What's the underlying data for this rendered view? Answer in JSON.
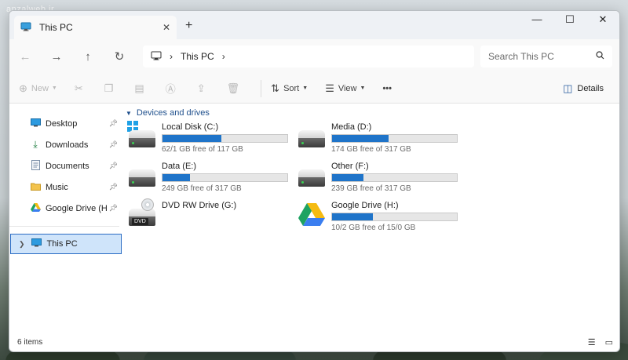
{
  "watermark": "anzalweb.ir",
  "tab": {
    "title": "This PC",
    "close": "✕",
    "new_tab": "+"
  },
  "window_controls": {
    "minimize": "—",
    "maximize": "☐",
    "close": "✕"
  },
  "nav": {
    "back": "←",
    "forward": "→",
    "up": "↑",
    "refresh": "↻"
  },
  "address": {
    "crumb": "This PC",
    "chevron": "›"
  },
  "search": {
    "placeholder": "Search This PC",
    "icon": "search-icon"
  },
  "toolbar": {
    "new_label": "New",
    "sort_label": "Sort",
    "view_label": "View",
    "more_label": "•••",
    "details_label": "Details"
  },
  "sidebar": {
    "items": [
      {
        "label": "Desktop",
        "icon": "desktop-icon",
        "pinned": true
      },
      {
        "label": "Downloads",
        "icon": "download-icon",
        "pinned": true
      },
      {
        "label": "Documents",
        "icon": "document-icon",
        "pinned": true
      },
      {
        "label": "Music",
        "icon": "folder-icon",
        "pinned": true
      },
      {
        "label": "Google Drive (H",
        "icon": "google-drive-icon",
        "pinned": true
      }
    ],
    "this_pc": "This PC"
  },
  "main": {
    "group_title": "Devices and drives",
    "drives": [
      {
        "name": "Local Disk (C:)",
        "free": "62/1 GB free of 117 GB",
        "used_fraction": 0.47,
        "icon": "windows-drive-icon"
      },
      {
        "name": "Media (D:)",
        "free": "174 GB free of 317 GB",
        "used_fraction": 0.45,
        "icon": "hard-drive-icon"
      },
      {
        "name": "Data (E:)",
        "free": "249 GB free of 317 GB",
        "used_fraction": 0.22,
        "icon": "hard-drive-icon"
      },
      {
        "name": "Other (F:)",
        "free": "239 GB free of 317 GB",
        "used_fraction": 0.25,
        "icon": "hard-drive-icon"
      },
      {
        "name": "DVD RW Drive (G:)",
        "free": "",
        "used_fraction": null,
        "icon": "dvd-drive-icon",
        "dvd_label": "DVD"
      },
      {
        "name": "Google Drive (H:)",
        "free": "10/2 GB free of 15/0 GB",
        "used_fraction": 0.33,
        "icon": "google-drive-icon"
      }
    ]
  },
  "status": {
    "items_count": "6 items"
  },
  "colors": {
    "accent": "#1f74c9",
    "selection": "#cfe4fa",
    "group_header": "#1e4f8c"
  }
}
